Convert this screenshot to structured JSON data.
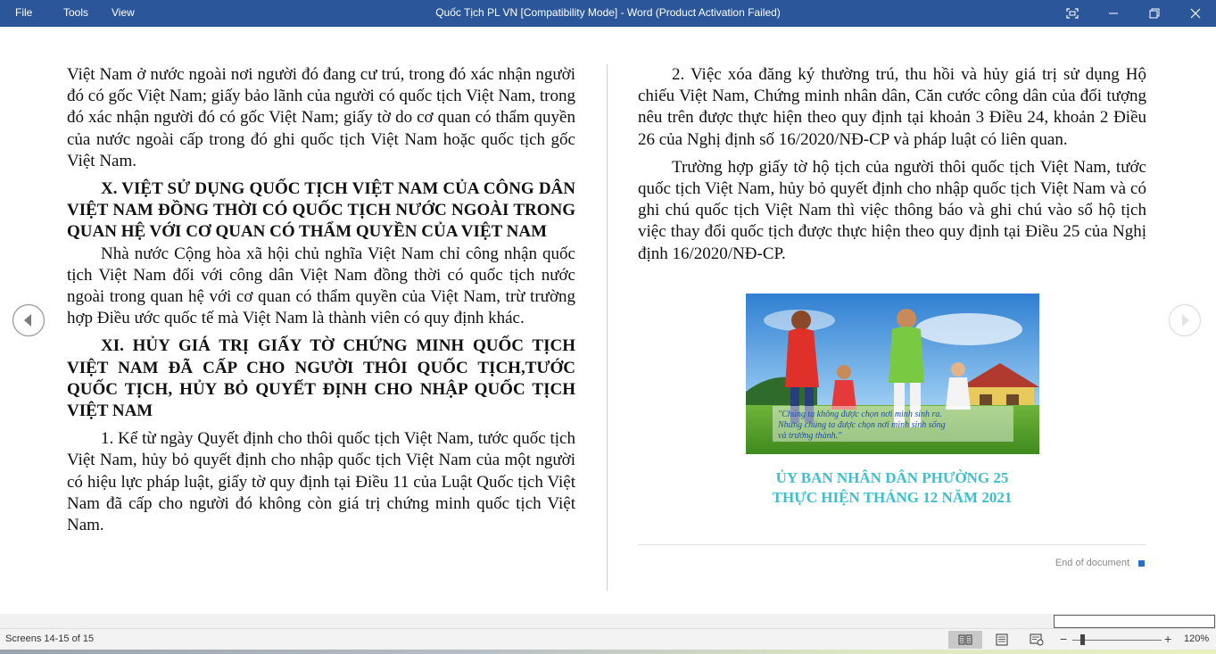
{
  "titlebar": {
    "menu": [
      "File",
      "Tools",
      "View"
    ],
    "title": "Quốc Tịch PL VN [Compatibility Mode]  -  Word (Product Activation Failed)",
    "icons": [
      "focus-mode-icon",
      "minimize-icon",
      "restore-icon",
      "close-icon"
    ]
  },
  "left_page": {
    "p1": "Việt Nam ở nước ngoài nơi người đó đang cư trú, trong đó xác nhận người đó có gốc Việt Nam; giấy bảo lãnh của người có quốc tịch Việt Nam, trong đó xác nhận người đó có gốc Việt Nam; giấy tờ do cơ quan có thẩm quyền của nước ngoài cấp trong đó ghi quốc tịch Việt Nam hoặc quốc tịch gốc Việt Nam.",
    "h1": "X. VIỆT SỬ DỤNG QUỐC TỊCH VIỆT NAM CỦA CÔNG DÂN VIỆT NAM ĐỒNG THỜI CÓ QUỐC TỊCH NƯỚC NGOÀI TRONG QUAN HỆ VỚI CƠ QUAN CÓ THẨM QUYỀN CỦA VIỆT NAM",
    "p2": "Nhà nước Cộng hòa xã hội chủ nghĩa Việt Nam chỉ công nhận quốc tịch Việt Nam đối với công dân Việt Nam đồng thời có quốc tịch nước ngoài trong quan hệ với cơ quan có thẩm quyền của Việt Nam, trừ trường hợp Điều ước quốc tế mà Việt Nam là thành viên có quy định khác.",
    "h2": "XI. HỦY GIÁ TRỊ GIẤY TỜ CHỨNG MINH QUỐC TỊCH VIỆT NAM ĐÃ CẤP CHO NGƯỜI THÔI QUỐC TỊCH,TƯỚC QUỐC TỊCH, HỦY BỎ QUYẾT ĐỊNH CHO NHẬP QUỐC TỊCH VIỆT NAM",
    "p3": "1. Kể từ ngày Quyết định cho thôi quốc tịch Việt Nam, tước quốc tịch Việt Nam, hủy bỏ quyết định cho nhập quốc tịch Việt Nam của một người có hiệu lực pháp luật, giấy tờ quy định tại Điều 11 của Luật Quốc tịch Việt Nam đã cấp cho người đó không còn giá trị chứng minh quốc tịch Việt Nam."
  },
  "right_page": {
    "p1": "2. Việc xóa đăng ký thường trú, thu hồi và hủy giá trị sử dụng Hộ chiếu Việt Nam, Chứng minh nhân dân, Căn cước công dân của đối tượng nêu trên được thực hiện theo quy định tại khoản 3 Điều 24, khoản 2 Điều 26 của Nghị định số 16/2020/NĐ-CP và pháp luật có liên quan.",
    "p2": "Trường hợp giấy tờ hộ tịch của người thôi quốc tịch Việt Nam, tước quốc tịch Việt Nam, hủy bỏ quyết định cho nhập quốc tịch Việt Nam và có ghi chú quốc tịch Việt Nam thì việc thông báo và ghi chú vào sổ hộ tịch việc thay đổi quốc tịch được thực hiện theo quy định tại Điều 25 của Nghị định 16/2020/NĐ-CP.",
    "photo_quote_1": "\"Chúng ta không được chọn nơi mình sinh ra.",
    "photo_quote_2": "Nhưng chúng ta được chọn nơi mình sinh sống",
    "photo_quote_3": "và trưởng thành.\"",
    "caption_1": "ỦY BAN NHÂN DÂN PHƯỜNG 25",
    "caption_2": "THỰC HIỆN THÁNG 12 NĂM 2021",
    "end_label": "End of document"
  },
  "nav": {
    "prev_icon": "chevron-left-circle-icon",
    "next_icon": "chevron-right-circle-icon"
  },
  "statusbar": {
    "screens": "Screens 14-15 of 15",
    "zoom": "120%",
    "zoom_minus": "−",
    "zoom_plus": "+",
    "views": [
      "read-mode-icon",
      "print-layout-icon",
      "web-layout-icon"
    ]
  },
  "colors": {
    "titlebar": "#2b579a",
    "caption": "#3cc0cc",
    "end_square": "#2b6fc0"
  }
}
